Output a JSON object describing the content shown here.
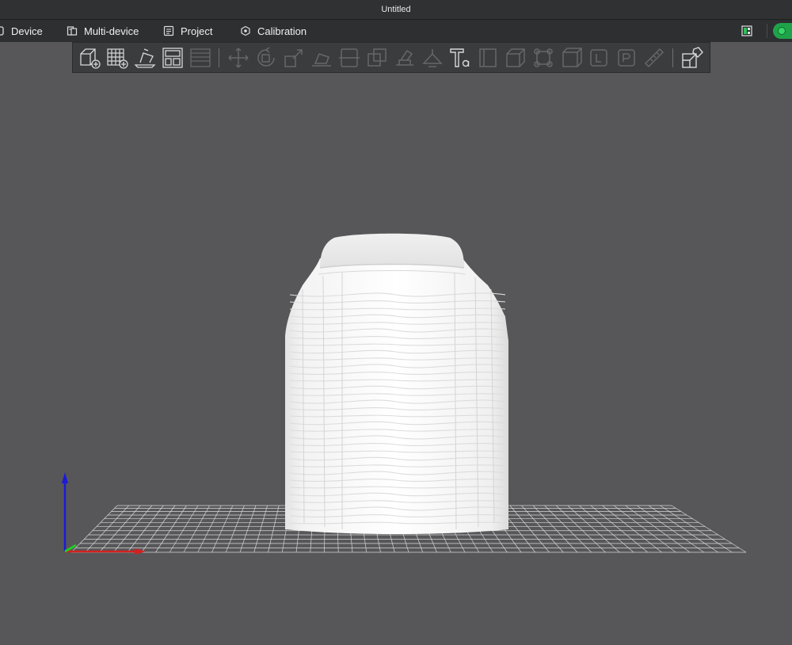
{
  "window": {
    "title": "Untitled"
  },
  "menu": {
    "device": "Device",
    "multi_device": "Multi-device",
    "project": "Project",
    "calibration": "Calibration"
  },
  "toolbar_icons": [
    "add-object-icon",
    "add-plate-icon",
    "auto-orient-icon",
    "arrange-icon",
    "split-plates-icon",
    "move-icon",
    "rotate-icon",
    "scale-icon",
    "lay-on-face-icon",
    "cut-icon",
    "mesh-boolean-icon",
    "support-paint-icon",
    "seam-paint-icon",
    "text-icon",
    "variable-layer-height-icon",
    "assembly-icon",
    "brim-ears-icon",
    "measure-icon",
    "assembly-view-icon",
    "fuzzy-skin-icon",
    "emboss-icon",
    "ruler-icon",
    "assemble-parts-icon"
  ],
  "colors": {
    "viewport_bg": "#575759",
    "status_ok": "#1fa34a",
    "axis_x": "#d42020",
    "axis_z": "#1a1ad8",
    "axis_y": "#22cc22"
  }
}
